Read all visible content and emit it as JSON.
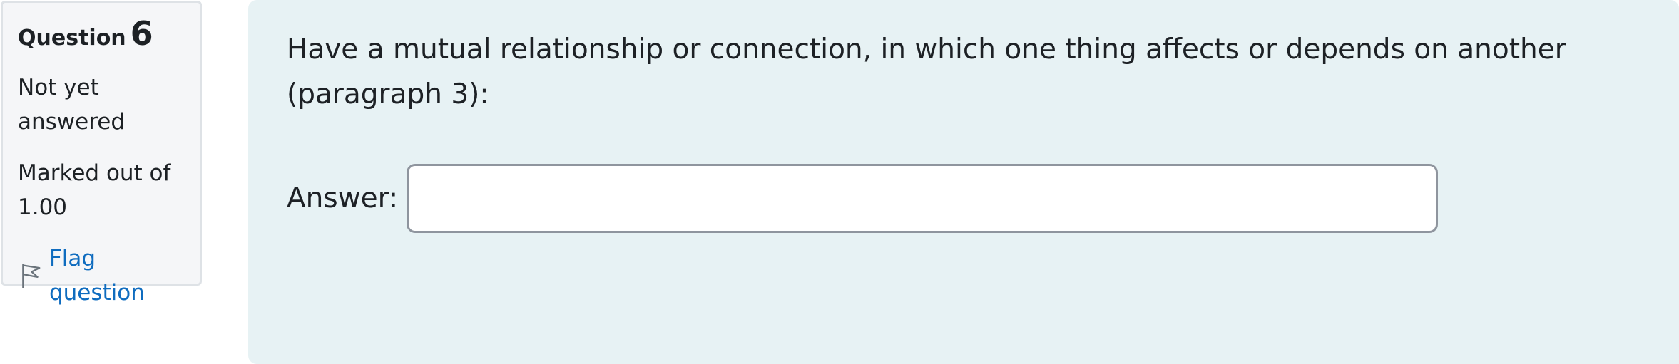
{
  "question_info": {
    "label": "Question",
    "number": "6",
    "state": "Not yet answered",
    "grade": "Marked out of 1.00",
    "flag_label": "Flag question"
  },
  "question": {
    "text": "Have a mutual relationship or connection, in which one thing affects or depends on another (paragraph 3):",
    "answer_label": "Answer:",
    "answer_value": "",
    "answer_placeholder": ""
  },
  "colors": {
    "info_bg": "#f5f6f8",
    "formulation_bg": "#e7f2f4",
    "link": "#0f6cbf"
  },
  "icons": {
    "flag": "flag-outline-icon"
  }
}
